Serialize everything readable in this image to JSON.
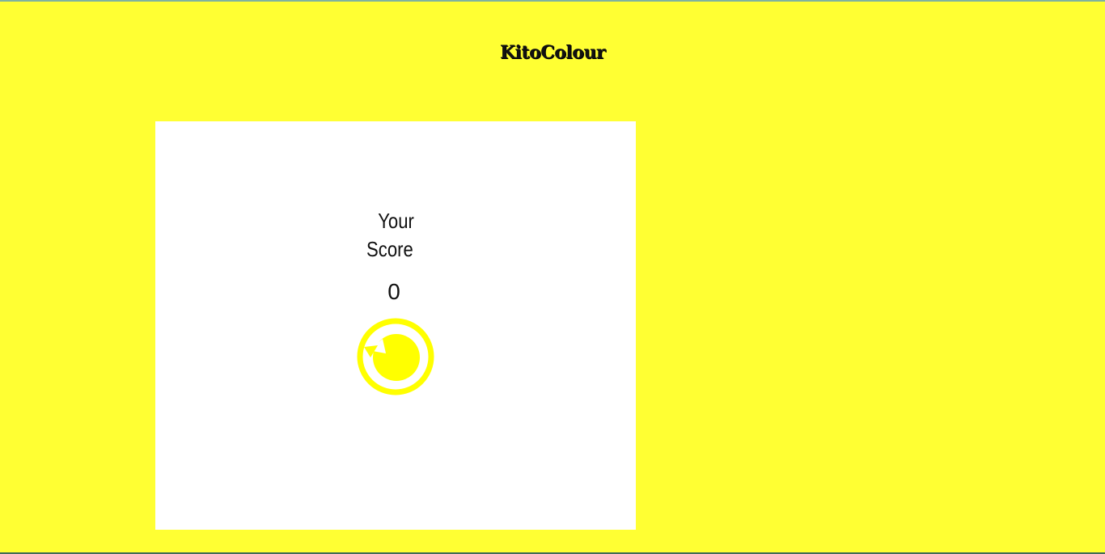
{
  "app": {
    "logo_text": "KitoColour"
  },
  "game_over": {
    "score_label_line1": "Your",
    "score_label_line2": "Score",
    "score_value": "0",
    "restart_icon": "restart-icon"
  },
  "colors": {
    "background": "#ffff33",
    "panel": "#ffffff",
    "accent": "#ffff00"
  }
}
